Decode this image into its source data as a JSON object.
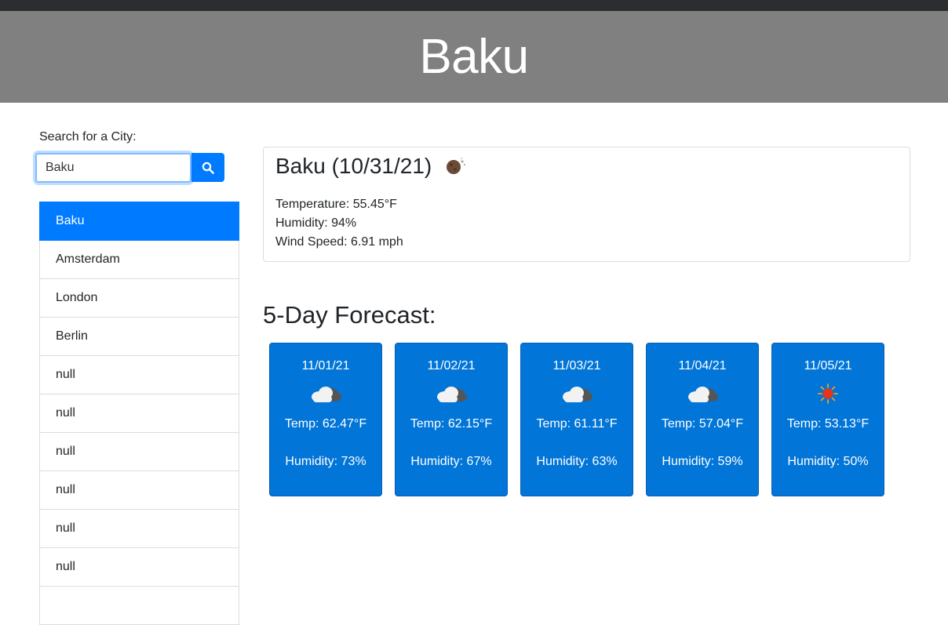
{
  "header": {
    "title": "Baku"
  },
  "search": {
    "label": "Search for a City:",
    "value": "Baku"
  },
  "history": {
    "items": [
      "Baku",
      "Amsterdam",
      "London",
      "Berlin",
      "null",
      "null",
      "null",
      "null",
      "null",
      "null",
      ""
    ],
    "active_index": 0
  },
  "current": {
    "title": "Baku (10/31/21)",
    "icon": "night-moon-cloud-icon",
    "temperature": "Temperature: 55.45°F",
    "humidity": "Humidity: 94%",
    "wind": "Wind Speed: 6.91 mph"
  },
  "forecast": {
    "title": "5-Day Forecast:",
    "days": [
      {
        "date": "11/01/21",
        "icon": "cloud-icon",
        "temp": "Temp: 62.47°F",
        "humidity": "Humidity: 73%"
      },
      {
        "date": "11/02/21",
        "icon": "cloud-icon",
        "temp": "Temp: 62.15°F",
        "humidity": "Humidity: 67%"
      },
      {
        "date": "11/03/21",
        "icon": "cloud-icon",
        "temp": "Temp: 61.11°F",
        "humidity": "Humidity: 63%"
      },
      {
        "date": "11/04/21",
        "icon": "cloud-icon",
        "temp": "Temp: 57.04°F",
        "humidity": "Humidity: 59%"
      },
      {
        "date": "11/05/21",
        "icon": "sun-icon",
        "temp": "Temp: 53.13°F",
        "humidity": "Humidity: 50%"
      }
    ]
  },
  "colors": {
    "header_bg": "#808080",
    "primary": "#007bff",
    "card_bg": "#0275d8"
  }
}
